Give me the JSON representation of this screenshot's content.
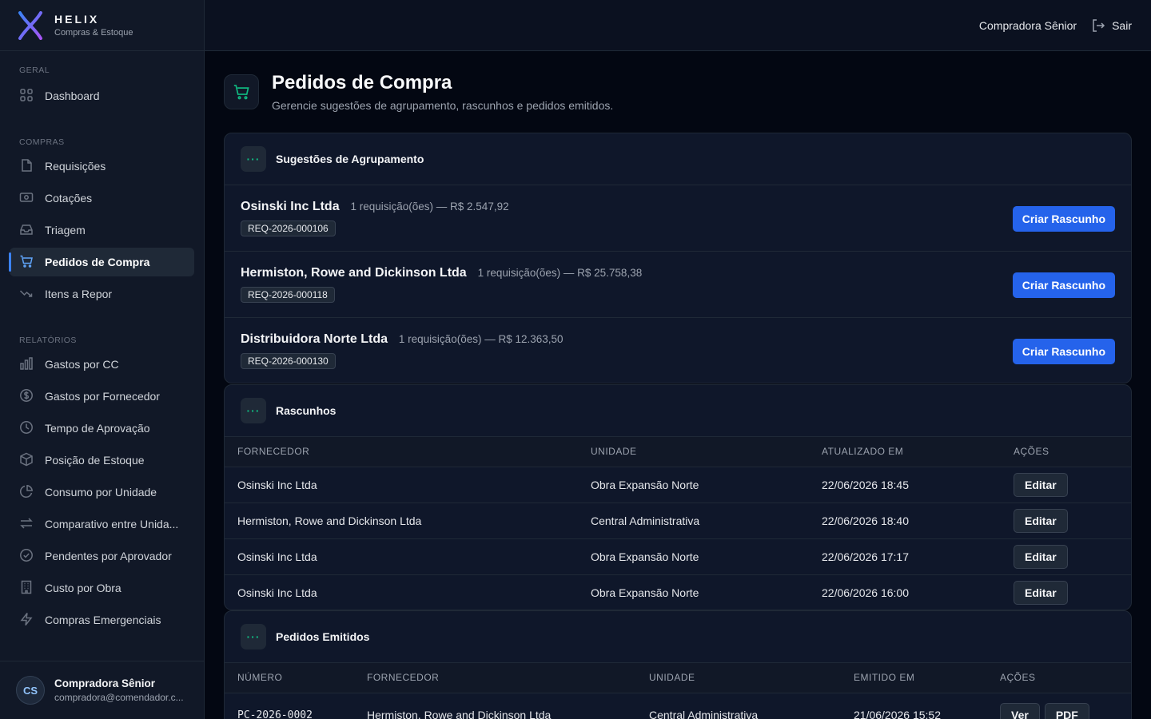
{
  "brand": {
    "name": "HELIX",
    "subtitle": "Compras & Estoque"
  },
  "topbar": {
    "role": "Compradora Sênior",
    "logout_label": "Sair"
  },
  "sidebar": {
    "sections": [
      {
        "label": "GERAL",
        "items": [
          {
            "label": "Dashboard",
            "icon": "grid-icon"
          }
        ]
      },
      {
        "label": "COMPRAS",
        "items": [
          {
            "label": "Requisições",
            "icon": "file-icon"
          },
          {
            "label": "Cotações",
            "icon": "banknote-icon"
          },
          {
            "label": "Triagem",
            "icon": "inbox-icon"
          },
          {
            "label": "Pedidos de Compra",
            "icon": "cart-icon",
            "active": true
          },
          {
            "label": "Itens a Repor",
            "icon": "trending-down-icon"
          }
        ]
      },
      {
        "label": "RELATÓRIOS",
        "items": [
          {
            "label": "Gastos por CC",
            "icon": "bar-chart-icon"
          },
          {
            "label": "Gastos por Fornecedor",
            "icon": "dollar-circle-icon"
          },
          {
            "label": "Tempo de Aprovação",
            "icon": "clock-icon"
          },
          {
            "label": "Posição de Estoque",
            "icon": "box-icon"
          },
          {
            "label": "Consumo por Unidade",
            "icon": "pie-chart-icon"
          },
          {
            "label": "Comparativo entre Unida...",
            "icon": "arrows-icon"
          },
          {
            "label": "Pendentes por Aprovador",
            "icon": "check-circle-icon"
          },
          {
            "label": "Custo por Obra",
            "icon": "building-icon"
          },
          {
            "label": "Compras Emergenciais",
            "icon": "zap-icon"
          }
        ]
      }
    ],
    "user": {
      "initials": "CS",
      "name": "Compradora Sênior",
      "email": "compradora@comendador.c..."
    }
  },
  "page": {
    "title": "Pedidos de Compra",
    "subtitle": "Gerencie sugestões de agrupamento, rascunhos e pedidos emitidos."
  },
  "suggestions": {
    "title": "Sugestões de Agrupamento",
    "button_label": "Criar Rascunho",
    "rows": [
      {
        "supplier": "Osinski Inc Ltda",
        "meta": "1 requisição(ões) — R$ 2.547,92",
        "req": "REQ-2026-000106"
      },
      {
        "supplier": "Hermiston, Rowe and Dickinson Ltda",
        "meta": "1 requisição(ões) — R$ 25.758,38",
        "req": "REQ-2026-000118"
      },
      {
        "supplier": "Distribuidora Norte Ltda",
        "meta": "1 requisição(ões) — R$ 12.363,50",
        "req": "REQ-2026-000130"
      }
    ]
  },
  "drafts": {
    "title": "Rascunhos",
    "columns": [
      "FORNECEDOR",
      "UNIDADE",
      "ATUALIZADO EM",
      "AÇÕES"
    ],
    "edit_label": "Editar",
    "rows": [
      {
        "supplier": "Osinski Inc Ltda",
        "unit": "Obra Expansão Norte",
        "updated": "22/06/2026 18:45"
      },
      {
        "supplier": "Hermiston, Rowe and Dickinson Ltda",
        "unit": "Central Administrativa",
        "updated": "22/06/2026 18:40"
      },
      {
        "supplier": "Osinski Inc Ltda",
        "unit": "Obra Expansão Norte",
        "updated": "22/06/2026 17:17"
      },
      {
        "supplier": "Osinski Inc Ltda",
        "unit": "Obra Expansão Norte",
        "updated": "22/06/2026 16:00"
      }
    ]
  },
  "issued": {
    "title": "Pedidos Emitidos",
    "columns": [
      "NÚMERO",
      "FORNECEDOR",
      "UNIDADE",
      "EMITIDO EM",
      "AÇÕES"
    ],
    "view_label": "Ver",
    "pdf_label": "PDF",
    "rows": [
      {
        "number": "PC-2026-0002",
        "supplier": "Hermiston, Rowe and Dickinson Ltda",
        "unit": "Central Administrativa",
        "issued": "21/06/2026 15:52"
      }
    ]
  },
  "colors": {
    "accent": "#2563eb",
    "brand_mark": "#6366f1",
    "icon_accent": "#10b981"
  }
}
